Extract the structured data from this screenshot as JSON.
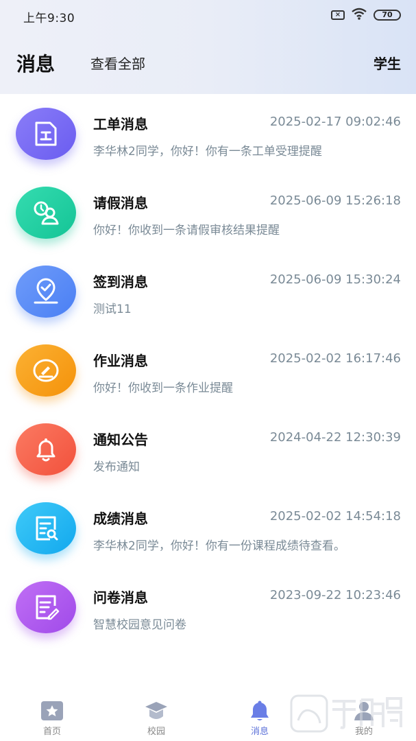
{
  "status_bar": {
    "time": "上午9:30",
    "sim_icon": "sim-x-icon",
    "wifi_icon": "wifi-icon",
    "battery": "70"
  },
  "nav": {
    "title": "消息",
    "view_all": "查看全部",
    "role": "学生"
  },
  "messages": [
    {
      "title": "工单消息",
      "time": "2025-02-17 09:02:46",
      "body": "李华林2同学，你好！你有一条工单受理提醒",
      "icon": "work-order-icon",
      "color": "#7b6cf6"
    },
    {
      "title": "请假消息",
      "time": "2025-06-09 15:26:18",
      "body": "你好！你收到一条请假审核结果提醒",
      "icon": "leave-user-clock-icon",
      "color": "#22cfa4"
    },
    {
      "title": "签到消息",
      "time": "2025-06-09 15:30:24",
      "body": "测试11",
      "icon": "check-in-location-icon",
      "color": "#5b8df7"
    },
    {
      "title": "作业消息",
      "time": "2025-02-02 16:17:46",
      "body": "你好！你收到一条作业提醒",
      "icon": "homework-pen-icon",
      "color": "#f8a01a"
    },
    {
      "title": "通知公告",
      "time": "2024-04-22 12:30:39",
      "body": "发布通知",
      "icon": "bell-icon",
      "color": "#f5654f"
    },
    {
      "title": "成绩消息",
      "time": "2025-02-02 14:54:18",
      "body": "李华林2同学，你好！你有一份课程成绩待查看。",
      "icon": "grade-report-icon",
      "color": "#1ab8f5"
    },
    {
      "title": "问卷消息",
      "time": "2023-09-22 10:23:46",
      "body": "智慧校园意见问卷",
      "icon": "survey-edit-icon",
      "color": "#b05af0"
    }
  ],
  "tabbar": {
    "tabs": [
      {
        "label": "首页",
        "icon": "home-star-icon"
      },
      {
        "label": "校园",
        "icon": "campus-cap-icon"
      },
      {
        "label": "消息",
        "icon": "message-bell-icon",
        "active": true
      },
      {
        "label": "我的",
        "icon": "profile-icon"
      }
    ]
  },
  "colors": {
    "accent": "#5a6fd8",
    "muted_text": "#7a8a96"
  }
}
